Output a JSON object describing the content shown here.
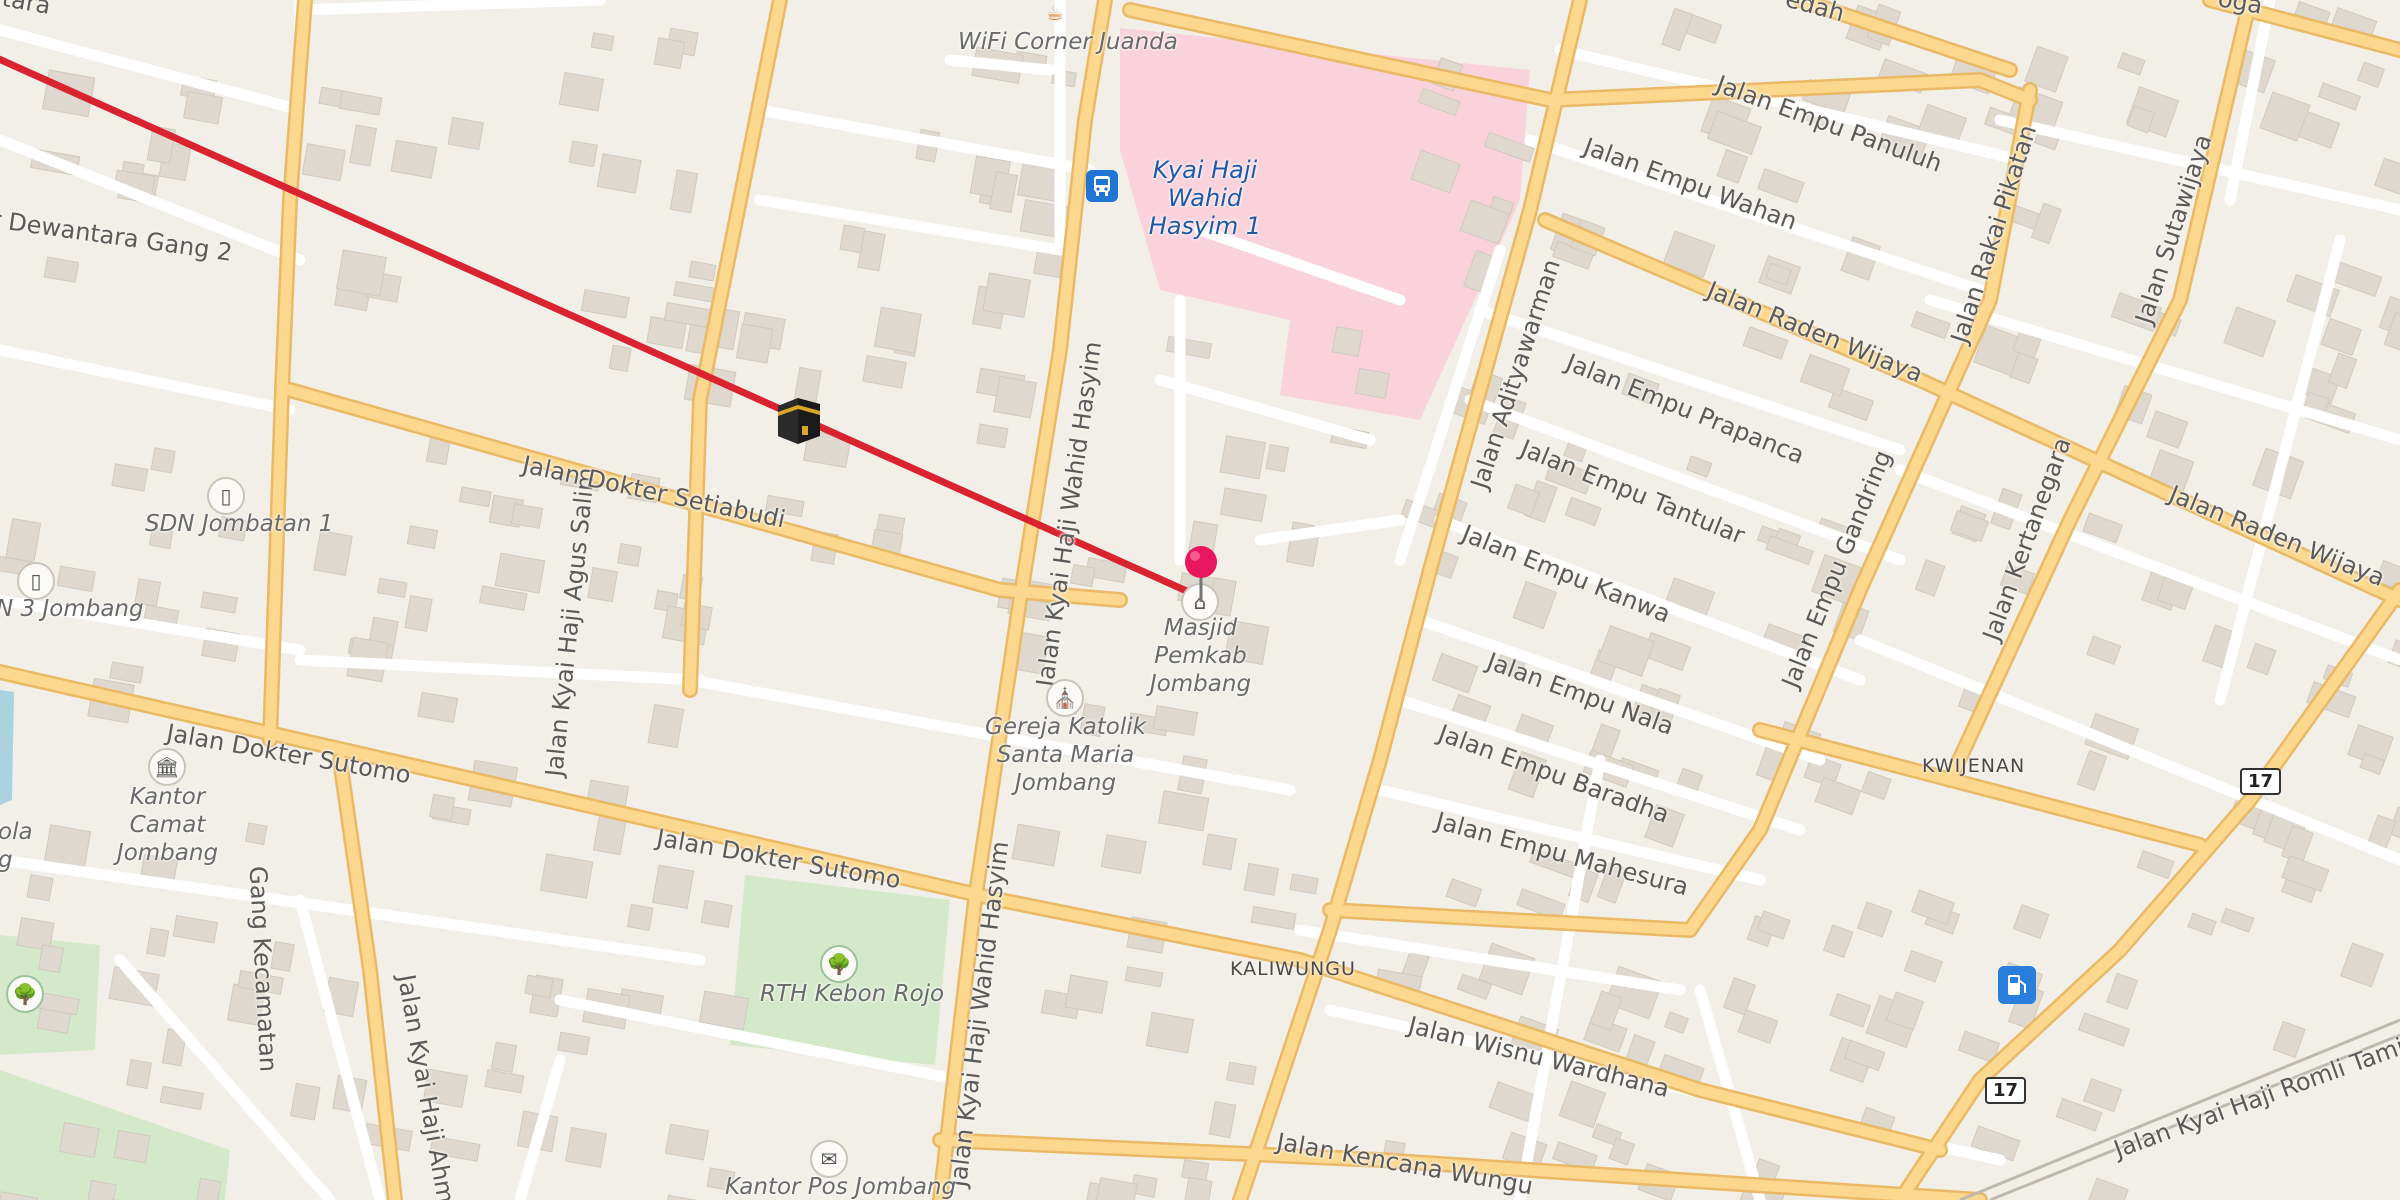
{
  "map": {
    "streets": [
      {
        "text": "Jalan Empu Panuluh"
      },
      {
        "text": "Jalan Empu Wahan"
      },
      {
        "text": "Jalan Raden Wijaya"
      },
      {
        "text": "Jalan Empu Prapanca"
      },
      {
        "text": "Jalan Empu Tantular"
      },
      {
        "text": "Jalan Empu Kanwa"
      },
      {
        "text": "Jalan Empu Nala"
      },
      {
        "text": "Jalan Empu Baradha"
      },
      {
        "text": "Jalan Empu Mahesura"
      },
      {
        "text": "Jalan Raden Wijaya"
      },
      {
        "text": "Jalan Rakai Pikatan"
      },
      {
        "text": "Jalan Sutawijaya"
      },
      {
        "text": "Jalan Empu Gandring"
      },
      {
        "text": "Jalan Kertanegara"
      },
      {
        "text": "Jalan Adityawarman"
      },
      {
        "text": "Jalan Kyai Haji Wahid Hasyim"
      },
      {
        "text": "Jalan Kyai Haji Wahid Hasyim"
      },
      {
        "text": "Jalan Kyai Haji Agus Salim"
      },
      {
        "text": "Jalan Dokter Setiabudi"
      },
      {
        "text": "Jalan Dokter Sutomo"
      },
      {
        "text": "Jalan Dokter Sutomo"
      },
      {
        "text": "Jalan Wisnu Wardhana"
      },
      {
        "text": "Jalan Kencana Wungu"
      },
      {
        "text": "Jalan Kyai Haji Romli Tamim"
      },
      {
        "text": "Gang Kecamatan"
      },
      {
        "text": "Jalan Kyai Haji Ahm"
      },
      {
        "text": "r Dewantara Gang 2"
      },
      {
        "text": "edah"
      },
      {
        "text": "tara"
      },
      {
        "text": "oga"
      }
    ],
    "districts": [
      {
        "text": "KWIJENAN"
      },
      {
        "text": "KALIWUNGU"
      }
    ],
    "pois": [
      {
        "name": "WiFi Corner Juanda",
        "icon": "cafe-icon"
      },
      {
        "name": "SDN Jombatan 1",
        "icon": "school-icon"
      },
      {
        "name": "N 3 Jombang",
        "icon": "school-icon"
      },
      {
        "name": "Kantor Camat Jombang",
        "icon": "townhall-icon"
      },
      {
        "name": "Masjid Pemkab Jombang",
        "icon": "mosque-icon"
      },
      {
        "name": "Gereja Katolik Santa Maria Jombang",
        "icon": "church-icon"
      },
      {
        "name": "RTH Kebon Rojo",
        "icon": "park-icon"
      },
      {
        "name": "Kantor Pos Jombang",
        "icon": "post-office-icon"
      },
      {
        "name": "ola\ng",
        "icon": ""
      }
    ],
    "bus_stop": {
      "name": "Kyai Haji Wahid Hasyim 1",
      "icon": "bus-stop-icon"
    },
    "fuel": {
      "icon": "fuel-station-icon"
    },
    "route_shields": [
      "17",
      "17"
    ],
    "markers": {
      "destination": "map-pin-icon",
      "qibla_origin": "kaaba-icon"
    },
    "colors": {
      "background": "#f2efe9",
      "building": "#ded8cf",
      "major_road_fill": "#fbd88e",
      "major_road_casing": "#e9b965",
      "minor_road": "#ffffff",
      "hospital_area": "#f9d2dc",
      "park": "#d2e8c8",
      "qibla_line": "#d9232e",
      "pin": "#e8155f"
    }
  }
}
